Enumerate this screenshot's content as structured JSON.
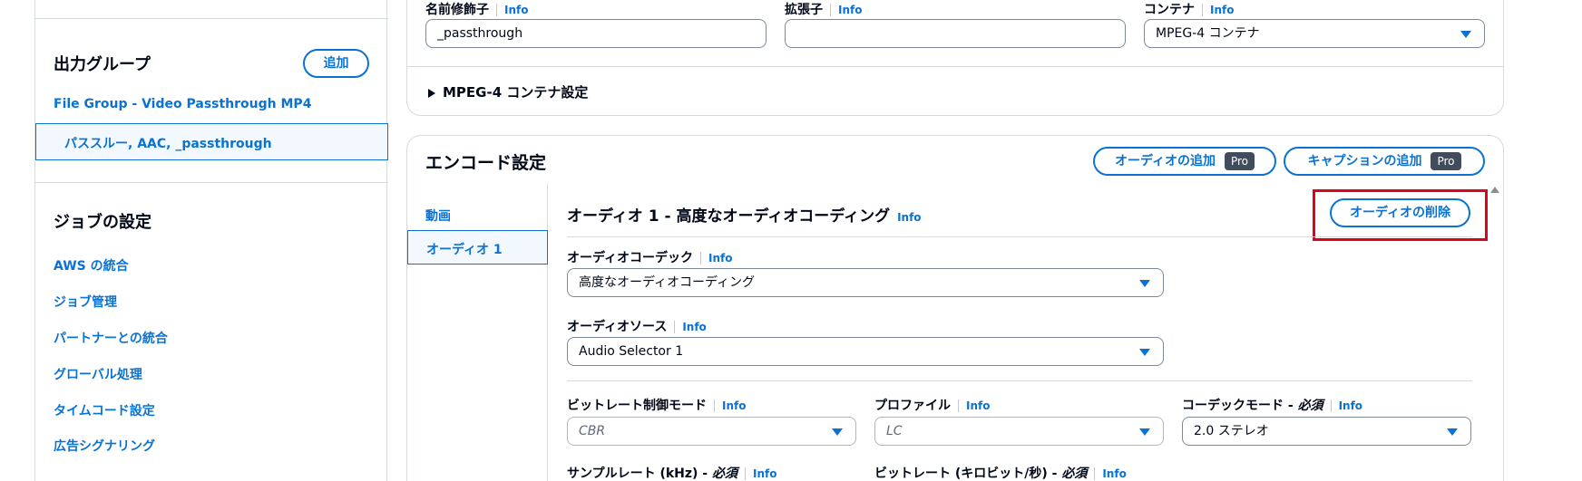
{
  "sidebar": {
    "output_groups_title": "出力グループ",
    "add_button": "追加",
    "group_name": "File Group - Video Passthrough MP4",
    "selected_output": "パススルー, AAC, _passthrough",
    "job_settings_title": "ジョブの設定",
    "job_items": [
      "AWS の統合",
      "ジョブ管理",
      "パートナーとの統合",
      "グローバル処理",
      "タイムコード設定",
      "広告シグナリング"
    ]
  },
  "output_settings": {
    "name_modifier_label": "名前修飾子",
    "name_modifier_value": "_passthrough",
    "extension_label": "拡張子",
    "extension_value": "",
    "container_label": "コンテナ",
    "container_value": "MPEG-4 コンテナ",
    "mpeg4_settings": "MPEG-4 コンテナ設定",
    "info": "Info"
  },
  "encode": {
    "title": "エンコード設定",
    "add_audio": "オーディオの追加",
    "add_caption": "キャプションの追加",
    "pro_badge": "Pro",
    "tabs": [
      "動画",
      "オーディオ 1"
    ],
    "audio_title": "オーディオ 1 - 高度なオーディオコーディング",
    "delete_audio": "オーディオの削除",
    "codec_label": "オーディオコーデック",
    "codec_value": "高度なオーディオコーディング",
    "source_label": "オーディオソース",
    "source_value": "Audio Selector 1",
    "bitrate_mode_label": "ビットレート制御モード",
    "bitrate_mode_value": "CBR",
    "profile_label": "プロファイル",
    "profile_value": "LC",
    "codec_mode_label": "コーデックモード - ",
    "required": "必須",
    "codec_mode_value": "2.0 ステレオ",
    "sample_rate_label": "サンプルレート (kHz) - ",
    "bitrate_label": "ビットレート (キロビット/秒) - "
  },
  "colors": {
    "link": "#0972d3",
    "highlight": "#e0021b",
    "selected_bg": "#f2f8fd"
  }
}
